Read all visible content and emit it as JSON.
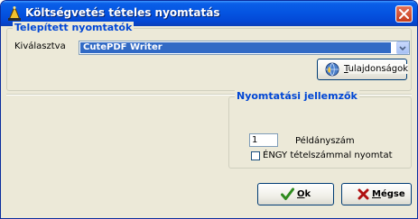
{
  "window": {
    "title": "Költségvetés tételes nyomtatás",
    "icon": "printer-wizard-icon",
    "close_icon": "close-icon"
  },
  "printers_group": {
    "legend": "Telepített nyomtatók",
    "selected_label": "Kiválasztva",
    "selected_value": "CutePDF Writer",
    "dropdown_icon": "chevron-down-icon",
    "properties_button": {
      "label": "Tulajdonságok",
      "mnemonic": "T",
      "icon": "properties-globe-icon"
    }
  },
  "print_settings_group": {
    "legend": "Nyomtatási jellemzők",
    "copies_value": "1",
    "copies_label": "Példányszám",
    "engy_checkbox": {
      "label": "ÉNGY tételszámmal nyomtat",
      "checked": false
    }
  },
  "buttons": {
    "ok": {
      "label": "Ok",
      "mnemonic": "O",
      "icon": "checkmark-icon",
      "icon_color": "#2e8b1e"
    },
    "cancel": {
      "label": "Mégse",
      "mnemonic": "M",
      "icon": "cross-icon",
      "icon_color": "#b01010"
    }
  },
  "colors": {
    "titlebar": "#0453e0",
    "selection": "#316ac5",
    "group_legend": "#0046d5",
    "dialog_background": "#ece9d8"
  }
}
